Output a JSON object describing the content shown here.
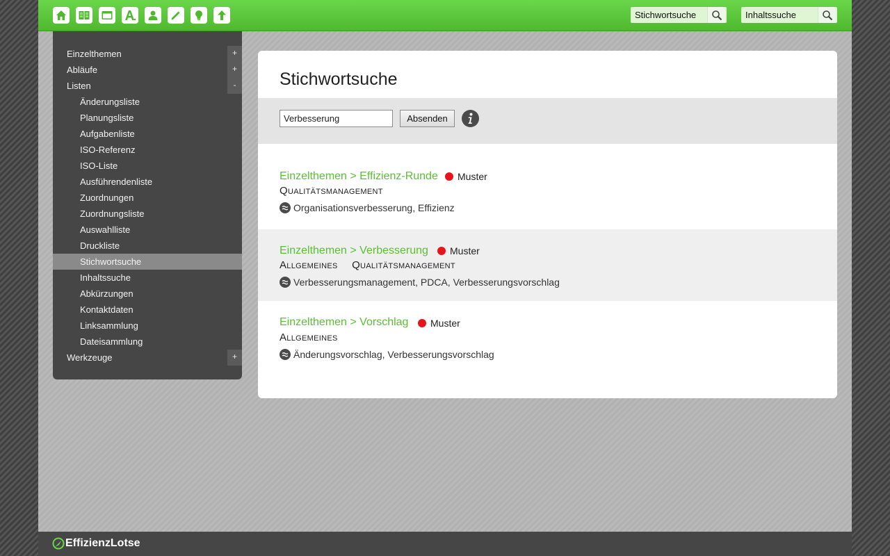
{
  "search": {
    "keyword_value": "Stichwortsuche",
    "content_value": "Inhaltssuche"
  },
  "sidebar": {
    "items": [
      {
        "label": "Einzelthemen",
        "toggle": "+"
      },
      {
        "label": "Abläufe",
        "toggle": "+"
      },
      {
        "label": "Listen",
        "toggle": "-"
      },
      {
        "label": "Änderungsliste"
      },
      {
        "label": "Planungsliste"
      },
      {
        "label": "Aufgabenliste"
      },
      {
        "label": "ISO-Referenz"
      },
      {
        "label": "ISO-Liste"
      },
      {
        "label": "Ausführendenliste"
      },
      {
        "label": "Zuordnungen"
      },
      {
        "label": "Zuordnungsliste"
      },
      {
        "label": "Auswahlliste"
      },
      {
        "label": "Druckliste"
      },
      {
        "label": "Stichwortsuche"
      },
      {
        "label": "Inhaltssuche"
      },
      {
        "label": "Abkürzungen"
      },
      {
        "label": "Kontaktdaten"
      },
      {
        "label": "Linksammlung"
      },
      {
        "label": "Dateisammlung"
      },
      {
        "label": "Werkzeuge",
        "toggle": "+"
      }
    ]
  },
  "main": {
    "title": "Stichwortsuche",
    "query_value": "Verbesserung",
    "submit_label": "Absenden",
    "results": [
      {
        "title": "Einzelthemen > Effizienz-Runde",
        "status": "Muster",
        "categories": [
          "Qualitätsmanagement"
        ],
        "tags": "Organisationsverbesserung, Effizienz"
      },
      {
        "title": "Einzelthemen > Verbesserung",
        "status": "Muster",
        "categories": [
          "Allgemeines",
          "Qualitätsmanagement"
        ],
        "tags": "Verbesserungsmanagement, PDCA, Verbesserungsvorschlag"
      },
      {
        "title": "Einzelthemen > Vorschlag",
        "status": "Muster",
        "categories": [
          "Allgemeines"
        ],
        "tags": "Änderungsvorschlag, Verbesserungsvorschlag"
      }
    ]
  },
  "footer": {
    "logo_text": "EffizienzLotse"
  },
  "colors": {
    "accent": "#5bbe35",
    "status_red": "#e8141b",
    "sidebar_bg": "#464646"
  }
}
